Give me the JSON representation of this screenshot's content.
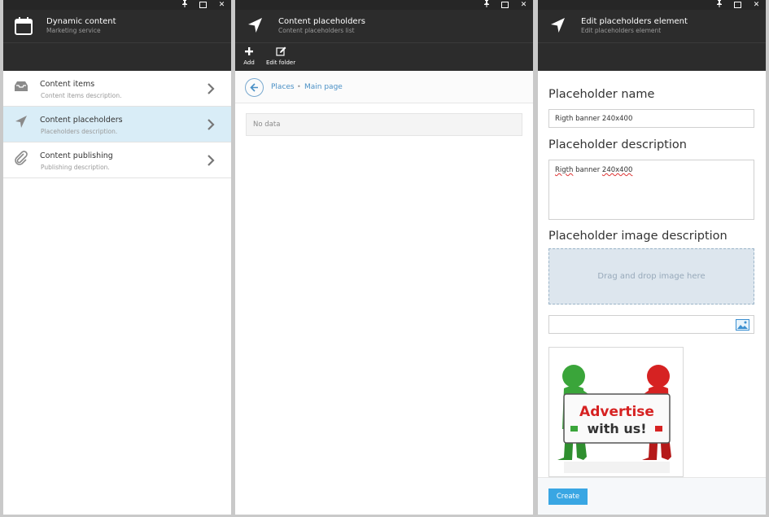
{
  "panes": {
    "dynamic": {
      "title": "Dynamic content",
      "subtitle": "Marketing service",
      "items": [
        {
          "label": "Content items",
          "desc": "Content items description."
        },
        {
          "label": "Content placeholders",
          "desc": "Placeholders description."
        },
        {
          "label": "Content publishing",
          "desc": "Publishing description."
        }
      ]
    },
    "placeholders": {
      "title": "Content placeholders",
      "subtitle": "Content placeholders list",
      "toolbar": {
        "add": "Add",
        "edit_folder": "Edit folder"
      },
      "breadcrumb": [
        "Places",
        "Main page"
      ],
      "breadcrumb_sep": "•",
      "empty_text": "No data"
    },
    "edit": {
      "title": "Edit placeholders element",
      "subtitle": "Edit placeholders element",
      "name_label": "Placeholder name",
      "name_value": "Rigth banner 240x400",
      "desc_label": "Placeholder description",
      "desc_value_word1": "Rigth",
      "desc_value_mid": " banner ",
      "desc_value_word2": "240x400",
      "image_label": "Placeholder image description",
      "dropzone_text": "Drag and drop image here",
      "image_url_value": "",
      "preview_line1": "Advertise",
      "preview_line2": "with us!",
      "create_label": "Create"
    }
  },
  "window_controls": {
    "pin": "pin-icon",
    "maximize": "maximize-icon",
    "close": "close-icon"
  },
  "colors": {
    "header_bg": "#2c2c2c",
    "active_item": "#d9edf7",
    "accent": "#39a6e3",
    "link": "#4a90c6"
  }
}
